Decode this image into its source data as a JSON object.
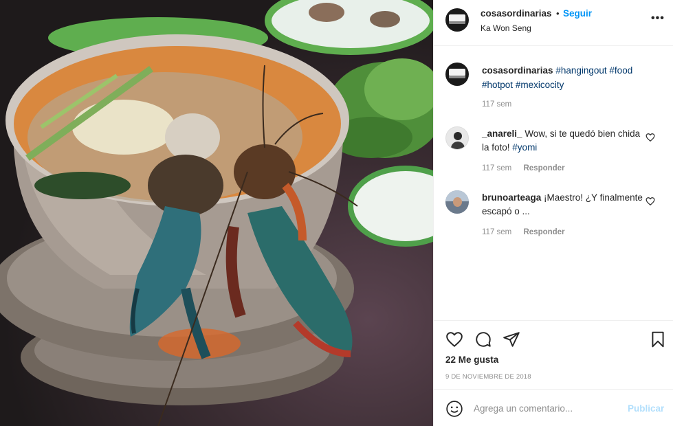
{
  "post": {
    "author": "cosasordinarias",
    "separator": "•",
    "follow_label": "Seguir",
    "location": "Ka Won Seng",
    "more_label": "•••"
  },
  "caption": {
    "user": "cosasordinarias",
    "hashtags": [
      "#hangingout",
      "#food",
      "#hotpot",
      "#mexicocity"
    ],
    "time": "117 sem"
  },
  "comments": [
    {
      "user": "_anareli_",
      "text": "Wow, si te quedó bien chida la foto!",
      "hashtag": "#yomi",
      "time": "117 sem",
      "reply_label": "Responder"
    },
    {
      "user": "brunoarteaga",
      "text": "¡Maestro! ¿Y finalmente escapó o ...",
      "time": "117 sem",
      "reply_label": "Responder"
    }
  ],
  "actions": {
    "like_icon": "heart-icon",
    "comment_icon": "comment-bubble-icon",
    "share_icon": "paper-plane-icon",
    "save_icon": "bookmark-icon"
  },
  "likes": "22 Me gusta",
  "date": "9 DE NOVIEMBRE DE 2018",
  "comment_box": {
    "emoji_icon": "smiley-icon",
    "placeholder": "Agrega un comentario...",
    "publish_label": "Publicar"
  },
  "colors": {
    "link_blue": "#0095f6",
    "hashtag_blue": "#00376b",
    "publish_disabled": "#b2dffc",
    "meta_gray": "#8e8e8e"
  }
}
